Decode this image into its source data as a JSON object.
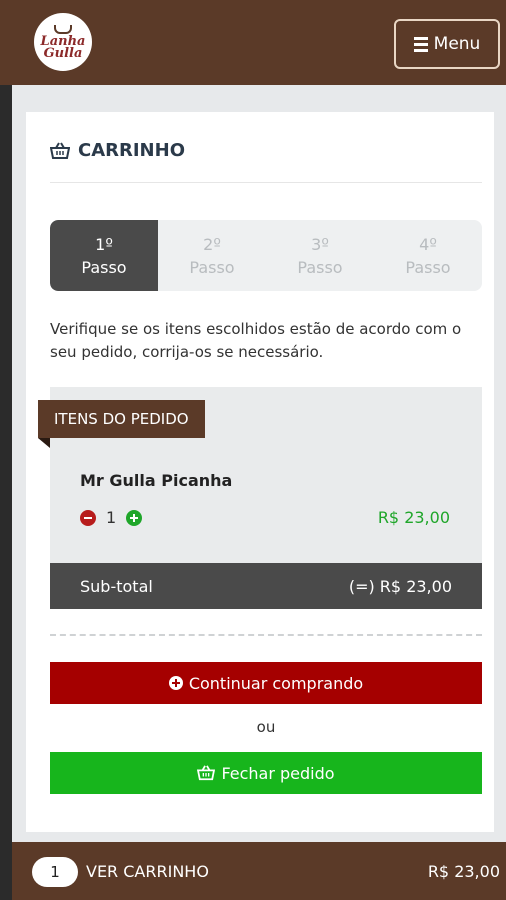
{
  "header": {
    "logo_line1": "Lanha",
    "logo_line2": "Gulla",
    "menu_label": "Menu"
  },
  "cart": {
    "title": "CARRINHO",
    "steps": [
      {
        "num": "1º",
        "label": "Passo",
        "active": true
      },
      {
        "num": "2º",
        "label": "Passo",
        "active": false
      },
      {
        "num": "3º",
        "label": "Passo",
        "active": false
      },
      {
        "num": "4º",
        "label": "Passo",
        "active": false
      }
    ],
    "description": "Verifique se os itens escolhidos estão de acordo com o seu pedido, corrija-os se necessário.",
    "items_header": "ITENS DO PEDIDO",
    "items": [
      {
        "name": "Mr Gulla Picanha",
        "quantity": "1",
        "price": "R$ 23,00"
      }
    ],
    "subtotal_label": "Sub-total",
    "subtotal_value": "(=) R$ 23,00",
    "continue_label": "Continuar comprando",
    "or_label": "ou",
    "close_label": "Fechar pedido"
  },
  "bottombar": {
    "count": "1",
    "view_cart_label": "VER CARRINHO",
    "total": "R$ 23,00"
  },
  "colors": {
    "brand_brown": "#5b3a28",
    "continue_red": "#a50000",
    "close_green": "#17b51c",
    "price_green": "#1fa62a",
    "dark_gray": "#4a4a4a"
  }
}
